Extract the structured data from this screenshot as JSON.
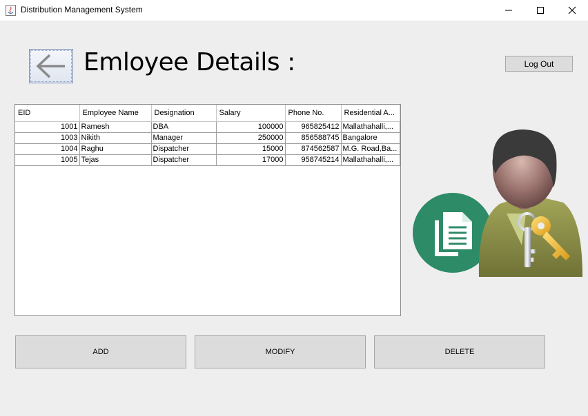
{
  "window": {
    "title": "Distribution Management System",
    "controls": [
      "minimize",
      "maximize",
      "close"
    ]
  },
  "header": {
    "back_icon": "arrow-left-icon",
    "title": "Emloyee Details :",
    "logout_label": "Log Out"
  },
  "table": {
    "columns": [
      "EID",
      "Employee Name",
      "Designation",
      "Salary",
      "Phone No.",
      "Residential A..."
    ],
    "rows": [
      [
        "1001",
        "Ramesh",
        "DBA",
        "100000",
        "965825412",
        "Mallathahalli,..."
      ],
      [
        "1003",
        "Nikith",
        "Manager",
        "250000",
        "856588745",
        "Bangalore"
      ],
      [
        "1004",
        "Raghu",
        "Dispatcher",
        "15000",
        "874562587",
        "M.G. Road,Ba..."
      ],
      [
        "1005",
        "Tejas",
        "Dispatcher",
        "17000",
        "958745214",
        "Mallathahalli,..."
      ]
    ]
  },
  "actions": {
    "add_label": "ADD",
    "modify_label": "MODIFY",
    "delete_label": "DELETE"
  },
  "illustration": {
    "icons": [
      "document-icon",
      "user-avatar-icon",
      "keys-icon"
    ]
  },
  "colors": {
    "accent_green": "#2e8b68",
    "button_bg": "#dcdcdc",
    "window_bg": "#eeeeee"
  }
}
